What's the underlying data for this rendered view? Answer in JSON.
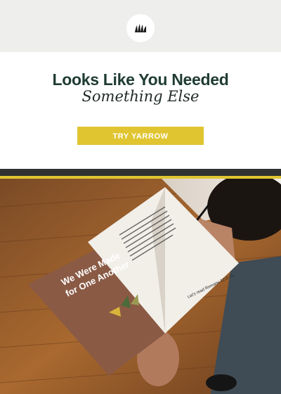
{
  "header": {
    "logo_icon": "yarrow-leaf-icon"
  },
  "hero": {
    "headline": "Looks Like You Needed",
    "subhead": "Something Else",
    "cta_label": "TRY YARROW"
  },
  "photo": {
    "book_title_line1": "We Were Made",
    "book_title_line2": "for One Another",
    "page_heading": "Let's read Romans 12:3-21."
  },
  "colors": {
    "accent": "#e0c531",
    "headline": "#1f3b34",
    "header_bg": "#eeeeed",
    "divider": "#2f3230",
    "book_cover": "#8a5a45"
  }
}
